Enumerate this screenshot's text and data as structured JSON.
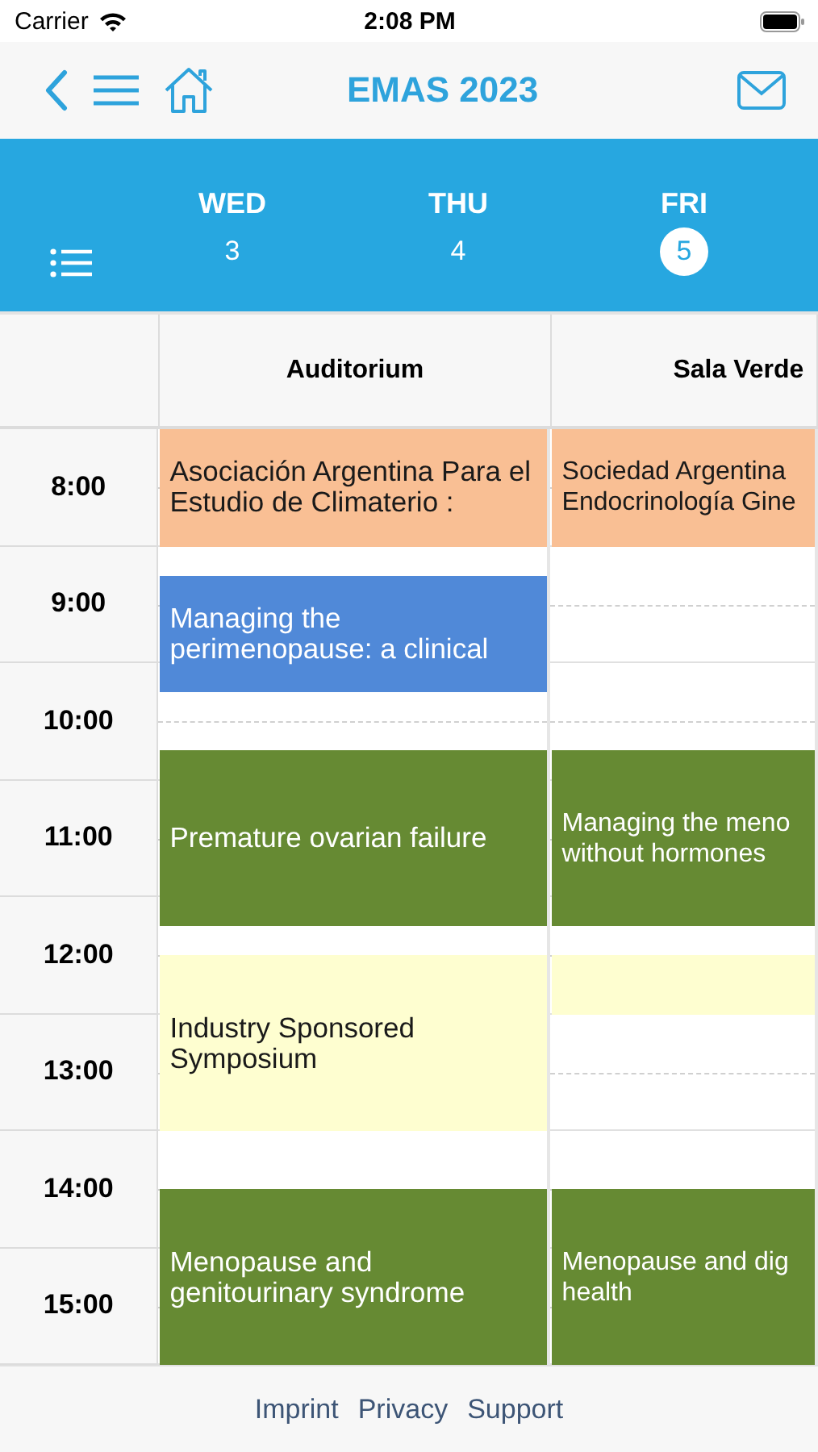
{
  "status_bar": {
    "carrier": "Carrier",
    "time": "2:08 PM"
  },
  "header": {
    "title": "EMAS 2023"
  },
  "days": [
    {
      "weekday": "WED",
      "date": "3",
      "selected": false
    },
    {
      "weekday": "THU",
      "date": "4",
      "selected": false
    },
    {
      "weekday": "FRI",
      "date": "5",
      "selected": true
    }
  ],
  "hours": [
    "8:00",
    "9:00",
    "10:00",
    "11:00",
    "12:00",
    "13:00",
    "14:00",
    "15:00"
  ],
  "rooms": [
    {
      "name": "Auditorium",
      "blocks": [
        {
          "kind": "hour",
          "title": "Asociación Argentina Para el Estudio de Climaterio :",
          "color": "#f9bf94"
        },
        {
          "kind": "quarter"
        },
        {
          "kind": "hour",
          "title": "Managing the perimenopause: a clinical",
          "color": "#5089d8"
        },
        {
          "kind": "half"
        },
        {
          "kind": "sesquihour",
          "title": "Premature ovarian failure",
          "color": "#668a33"
        },
        {
          "kind": "quarter"
        },
        {
          "kind": "sesquihour",
          "title": "Industry Sponsored Symposium",
          "color": "#fefed0"
        },
        {
          "kind": "half"
        },
        {
          "kind": "sesquihour",
          "title": "Menopause and genitourinary syndrome",
          "color": "#668a33"
        }
      ]
    },
    {
      "name": "Sala Verde",
      "blocks": [
        {
          "kind": "hour",
          "title": "Sociedad Argentina Endocrinología Gine",
          "color": "#f9bf94"
        },
        {
          "kind": "longgap"
        },
        {
          "kind": "sesquihour",
          "title": "Managing the meno without hormones",
          "color": "#668a33"
        },
        {
          "kind": "quarter"
        },
        {
          "kind": "half",
          "color": "#fefed0"
        },
        {
          "kind": "sesquihour"
        },
        {
          "kind": "sesquihour",
          "title": "Menopause and dig health",
          "color": "#668a33"
        }
      ]
    }
  ],
  "footer_links": [
    "Imprint",
    "Privacy",
    "Support"
  ]
}
